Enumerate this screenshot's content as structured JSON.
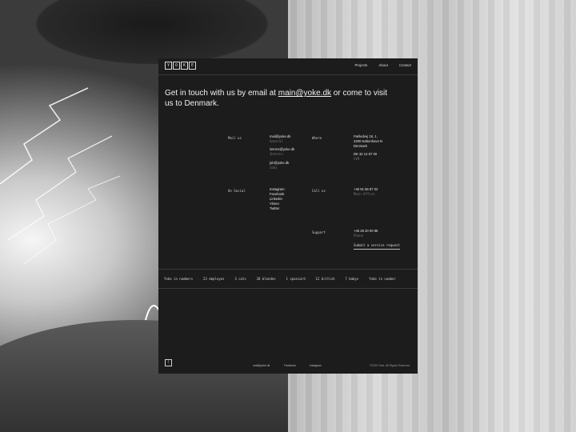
{
  "logo": {
    "letters": [
      "Y",
      "O",
      "K",
      "E"
    ]
  },
  "nav": {
    "projects": "Projects",
    "about": "About",
    "contact": "Contact"
  },
  "headline": {
    "prefix": "Get in touch with us by email at ",
    "email": "main@yoke.dk",
    "suffix": " or come to visit us to Denmark."
  },
  "mail": {
    "label": "Mail us",
    "general_email": "mail@yoke.dk",
    "general_label": "General",
    "interns_email": "interns@yoke.dk",
    "interns_label": "Interns",
    "jobs_email": "job@yoke.dk",
    "jobs_label": "Jobs"
  },
  "where": {
    "label": "Where",
    "address_line1": "Fælledvej 18, 1.",
    "address_line2": "2200 København N",
    "country": "Denmark",
    "cvr_number": "DK 32 14 87 00",
    "cvr_label": "CVR"
  },
  "social": {
    "label": "On Social",
    "items": [
      "Instagram",
      "Facebook",
      "LinkedIn",
      "Vimeo",
      "Twitter"
    ]
  },
  "call": {
    "label": "Call us",
    "phone": "+45 91 56 87 02",
    "phone_label": "Main Office"
  },
  "support": {
    "label": "Support",
    "phone": "+45 26 20 00 96",
    "phone_label": "Phone",
    "button": "Submit a service request"
  },
  "ticker": {
    "items": [
      "Yoke in numbers",
      "23 employes",
      "3 cats",
      "20 blondes",
      "1 spaniard",
      "12 british",
      "7 babys",
      "Yoke in number"
    ]
  },
  "footer": {
    "email": "mail@yoke.dk",
    "facebook": "Facebook",
    "instagram": "Instagram",
    "copyright": "©2019 Yoke. All Rights Reserved."
  }
}
